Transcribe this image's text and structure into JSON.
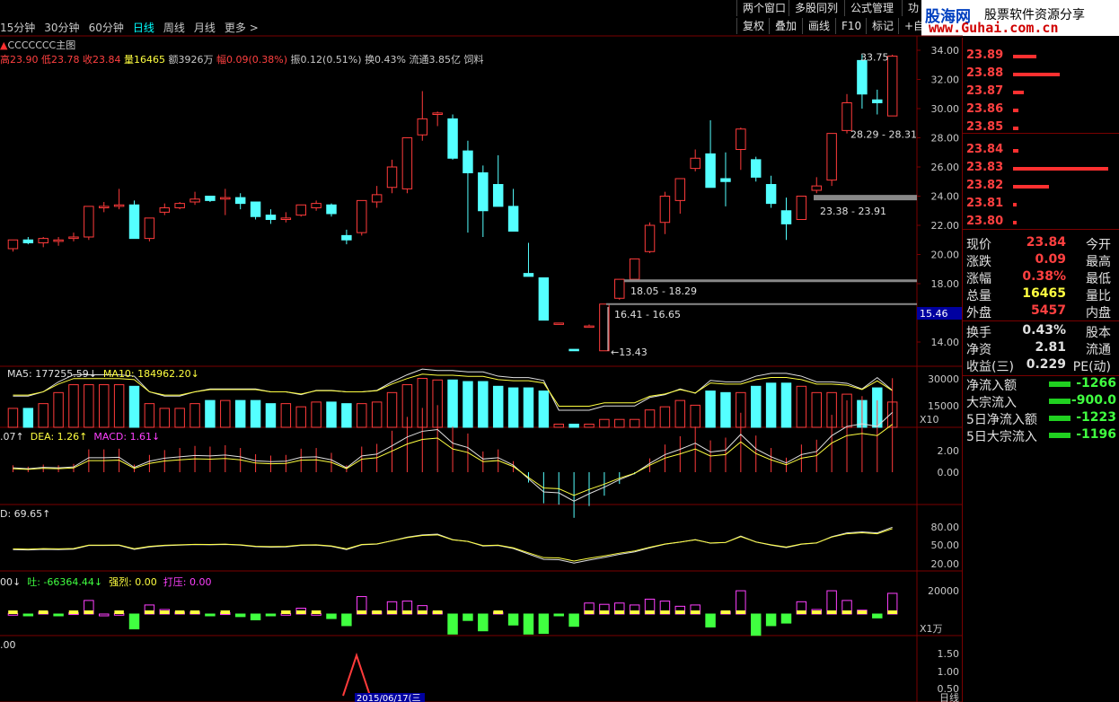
{
  "tabs": [
    "15分钟",
    "30分钟",
    "60分钟",
    "日线",
    "周线",
    "月线",
    "更多 >"
  ],
  "active_tab": "日线",
  "toolbar_top": [
    "两个窗口",
    "多股同列",
    "公式管理",
    "功"
  ],
  "toolbar_bottom": [
    "复权",
    "叠加",
    "画线",
    "F10",
    "标记",
    "+自"
  ],
  "logo": {
    "brand": "股海网",
    "slogan": "股票软件资源分享",
    "url": "www.Guhai.com.cn"
  },
  "chart_title": "CCCCCCC主图",
  "infoline": {
    "high": "高23.90",
    "low": "低23.78",
    "close": "收23.84",
    "vol": "量16465",
    "amount": "额3926万",
    "change": "幅0.09(0.38%)",
    "amp": "振0.12(0.51%)",
    "turnover": "换0.43%",
    "float": "流通3.85亿",
    "extra": "饲料"
  },
  "vol_label": {
    "ma5": "MA5: 177255.59↓",
    "ma10": "MA10: 184962.20↓"
  },
  "macd_label": {
    "diff": ".07↑",
    "dea": "DEA: 1.26↑",
    "macd": "MACD: 1.61↓"
  },
  "kdj_label": "D: 69.65↑",
  "flow_label": {
    "a": "00↓",
    "tu": "吐: -66364.44↓",
    "strong": "强烈: 0.00",
    "press": "打压: 0.00"
  },
  "sig_label": ".00",
  "date_label": "2015/06/17(三",
  "period_label": "日线",
  "price_axis": [
    "34.00",
    "32.00",
    "30.00",
    "28.00",
    "26.00",
    "24.00",
    "22.00",
    "20.00",
    "18.00",
    "16.00",
    "14.00"
  ],
  "vol_axis": [
    "30000",
    "15000"
  ],
  "vol_unit": "X10",
  "macd_axis": [
    "2.00",
    "0.00"
  ],
  "kdj_axis": [
    "80.00",
    "50.00",
    "20.00"
  ],
  "flow_axis": [
    "20000"
  ],
  "flow_unit": "X1万",
  "sig_axis": [
    "1.50",
    "1.00",
    "0.50"
  ],
  "current_price_tag": "15.46",
  "annotations": {
    "peak": "33.75",
    "zone1": "28.29 - 28.31",
    "zone2": "23.38 - 23.91",
    "zone3": "18.05 - 18.29",
    "zone4": "16.41 - 16.65",
    "low": "13.43"
  },
  "order_book": {
    "prices": [
      "23.89",
      "23.88",
      "23.87",
      "23.86",
      "23.85",
      "23.84",
      "23.83",
      "23.82",
      "23.81",
      "23.80"
    ],
    "volumes": [
      26,
      52,
      12,
      6,
      6,
      6,
      106,
      40,
      4,
      4
    ]
  },
  "quote": [
    {
      "k": "现价",
      "v": "23.84",
      "k2": "今开",
      "color": "#ff4040"
    },
    {
      "k": "涨跌",
      "v": "0.09",
      "k2": "最高",
      "color": "#ff4040"
    },
    {
      "k": "涨幅",
      "v": "0.38%",
      "k2": "最低",
      "color": "#ff4040"
    },
    {
      "k": "总量",
      "v": "16465",
      "k2": "量比",
      "color": "#ffff40"
    },
    {
      "k": "外盘",
      "v": "5457",
      "k2": "内盘",
      "color": "#ff4040"
    },
    {
      "k": "换手",
      "v": "0.43%",
      "k2": "股本",
      "color": "#e0e0e0"
    },
    {
      "k": "净资",
      "v": "2.81",
      "k2": "流通",
      "color": "#e0e0e0"
    },
    {
      "k": "收益(三)",
      "v": "0.229",
      "k2": "PE(动)",
      "color": "#e0e0e0"
    }
  ],
  "flows": [
    {
      "k": "净流入额",
      "v": "-1266"
    },
    {
      "k": "大宗流入",
      "v": "-900.0"
    },
    {
      "k": "5日净流入额",
      "v": "-1223"
    },
    {
      "k": "5日大宗流入",
      "v": "-1196"
    }
  ],
  "colors": {
    "up": "#ff3b3b",
    "down": "#54ffff",
    "axis": "#7a0000",
    "text": "#c8c8c8"
  },
  "chart_data": {
    "type": "candlestick",
    "title": "CCCCCCC主图",
    "ylim": [
      12.5,
      35
    ],
    "candles": [
      [
        20.4,
        21.0,
        20.2,
        21.0
      ],
      [
        21.0,
        21.2,
        20.7,
        20.8
      ],
      [
        20.8,
        21.2,
        20.5,
        21.1
      ],
      [
        20.9,
        21.2,
        20.6,
        21.0
      ],
      [
        21.1,
        21.5,
        20.9,
        21.2
      ],
      [
        21.2,
        23.3,
        21.0,
        23.3
      ],
      [
        23.2,
        23.6,
        22.9,
        23.3
      ],
      [
        23.3,
        24.5,
        23.1,
        23.4
      ],
      [
        23.4,
        23.7,
        21.1,
        21.1
      ],
      [
        21.1,
        22.5,
        20.9,
        22.5
      ],
      [
        22.9,
        23.5,
        22.7,
        23.2
      ],
      [
        23.2,
        23.6,
        23.1,
        23.5
      ],
      [
        23.6,
        24.3,
        23.4,
        23.8
      ],
      [
        24.0,
        24.0,
        23.6,
        23.7
      ],
      [
        23.8,
        24.5,
        22.7,
        23.9
      ],
      [
        23.9,
        24.2,
        23.1,
        23.5
      ],
      [
        23.6,
        23.6,
        22.4,
        22.6
      ],
      [
        22.7,
        23.1,
        22.1,
        22.4
      ],
      [
        22.4,
        22.9,
        22.2,
        22.5
      ],
      [
        22.7,
        23.4,
        22.6,
        23.4
      ],
      [
        23.2,
        23.7,
        23.0,
        23.5
      ],
      [
        23.4,
        23.5,
        22.6,
        22.8
      ],
      [
        21.3,
        21.7,
        20.7,
        21.0
      ],
      [
        21.5,
        23.6,
        21.3,
        23.7
      ],
      [
        23.6,
        24.7,
        23.2,
        24.1
      ],
      [
        24.6,
        26.5,
        24.2,
        26.0
      ],
      [
        24.5,
        28.0,
        24.2,
        28.0
      ],
      [
        28.2,
        31.2,
        27.8,
        29.3
      ],
      [
        29.6,
        29.8,
        28.8,
        29.7
      ],
      [
        29.3,
        29.6,
        26.5,
        26.6
      ],
      [
        27.1,
        27.8,
        21.5,
        25.6
      ],
      [
        25.6,
        26.1,
        21.2,
        23.0
      ],
      [
        24.8,
        26.8,
        24.0,
        23.3
      ],
      [
        23.3,
        24.5,
        21.8,
        21.6
      ],
      [
        18.7,
        20.8,
        18.7,
        18.5
      ],
      [
        18.4,
        18.4,
        15.5,
        15.5
      ],
      [
        15.3,
        15.3,
        15.3,
        15.3
      ],
      [
        13.5,
        13.5,
        13.4,
        13.4
      ],
      [
        15.1,
        15.2,
        15.0,
        15.1
      ],
      [
        13.4,
        16.6,
        13.4,
        16.6
      ],
      [
        17.0,
        18.3,
        16.9,
        18.3
      ],
      [
        18.3,
        19.7,
        18.2,
        19.7
      ],
      [
        20.2,
        22.2,
        20.1,
        22.0
      ],
      [
        22.2,
        24.3,
        21.4,
        24.0
      ],
      [
        23.7,
        25.0,
        22.8,
        25.2
      ],
      [
        25.9,
        27.2,
        25.7,
        26.6
      ],
      [
        26.9,
        29.2,
        26.3,
        24.6
      ],
      [
        25.2,
        27.0,
        23.3,
        25.0
      ],
      [
        27.2,
        28.7,
        25.8,
        28.6
      ],
      [
        26.5,
        26.7,
        25.0,
        25.3
      ],
      [
        24.8,
        25.4,
        23.2,
        23.5
      ],
      [
        23.0,
        23.9,
        21.0,
        22.1
      ],
      [
        22.4,
        24.0,
        22.4,
        24.0
      ],
      [
        24.4,
        25.3,
        24.2,
        24.7
      ],
      [
        25.1,
        28.2,
        24.7,
        28.3
      ],
      [
        28.5,
        31.0,
        28.3,
        30.4
      ],
      [
        33.3,
        33.7,
        30.0,
        31.0
      ],
      [
        30.6,
        31.3,
        29.6,
        30.4
      ],
      [
        29.5,
        33.7,
        29.5,
        33.6
      ]
    ]
  }
}
